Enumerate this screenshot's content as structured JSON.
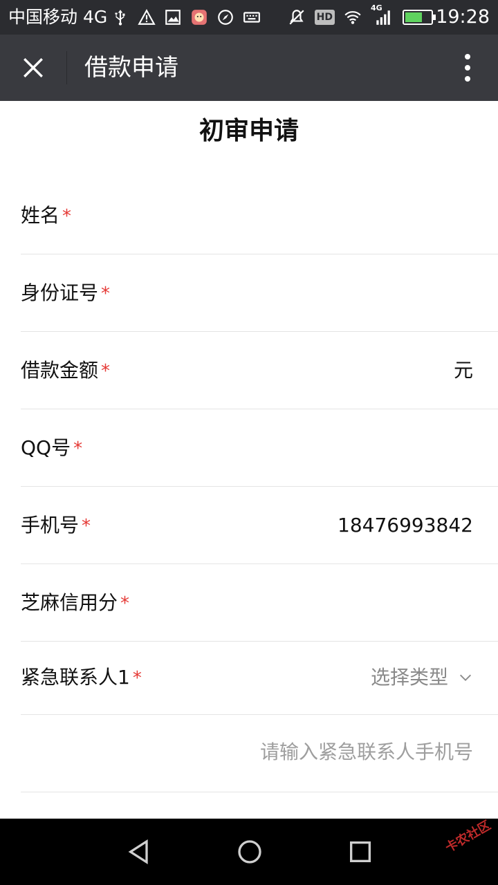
{
  "status_bar": {
    "carrier": "中国移动 4G",
    "hd": "HD",
    "network_tag": "4G",
    "time": "19:28"
  },
  "title_bar": {
    "title": "借款申请"
  },
  "form": {
    "heading": "初审申请",
    "required_mark": "*",
    "fields": [
      {
        "label": "姓名",
        "value": ""
      },
      {
        "label": "身份证号",
        "value": ""
      },
      {
        "label": "借款金额",
        "value": "",
        "unit": "元"
      },
      {
        "label": "QQ号",
        "value": ""
      },
      {
        "label": "手机号",
        "value": "18476993842"
      },
      {
        "label": "芝麻信用分",
        "value": ""
      },
      {
        "label": "紧急联系人1",
        "select": "选择类型"
      }
    ],
    "contact_phone_placeholder": "请输入紧急联系人手机号"
  },
  "watermark": "卡农社区",
  "colors": {
    "status_bar_bg": "#2b2c30",
    "title_bar_bg": "#393a3f",
    "required": "#e53935",
    "placeholder": "#9e9e9e"
  }
}
